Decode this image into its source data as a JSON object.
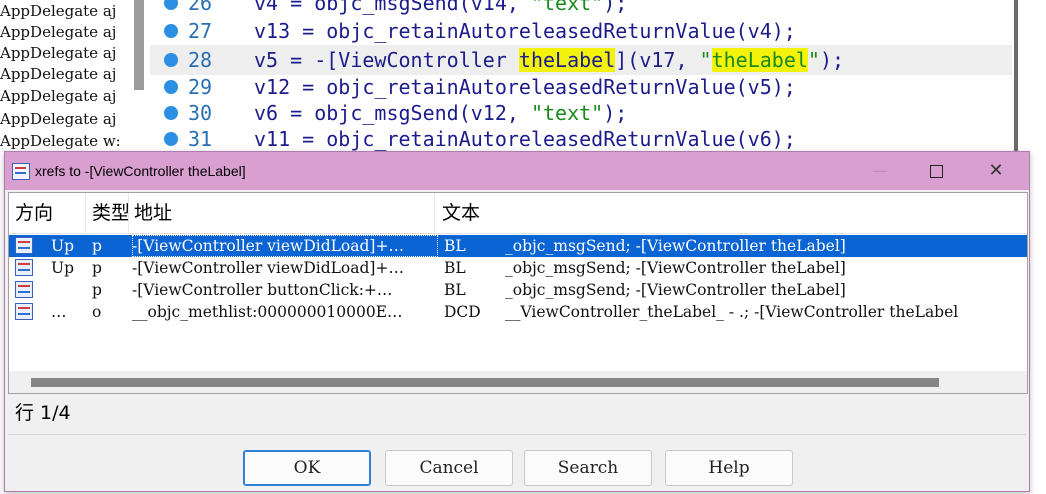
{
  "left_pane": {
    "functions": [
      "AppDelegate aj",
      "AppDelegate aj",
      "AppDelegate aj",
      "AppDelegate aj",
      "AppDelegate aj",
      "AppDelegate aj",
      "AppDelegate w:"
    ]
  },
  "code": {
    "lines": [
      {
        "num": "26",
        "pre": "v4 = objc_msgSend(v14, ",
        "str": "\"text\"",
        "post": ");"
      },
      {
        "num": "27",
        "text": "v13 = objc_retainAutoreleasedReturnValue(v4);"
      },
      {
        "num": "28",
        "pre": "v5 = -[ViewController ",
        "hl1": "theLabel",
        "mid": "](v17, ",
        "q1": "\"",
        "hl2": "theLabel",
        "q2": "\"",
        "post": ");"
      },
      {
        "num": "29",
        "text": "v12 = objc_retainAutoreleasedReturnValue(v5);"
      },
      {
        "num": "30",
        "pre": "v6 = objc_msgSend(v12, ",
        "str": "\"text\"",
        "post": ");"
      },
      {
        "num": "31",
        "text": "v11 = objc_retainAutoreleasedReturnValue(v6);"
      }
    ]
  },
  "dialog": {
    "title": "xrefs to -[ViewController theLabel]",
    "columns": {
      "direction": "方向",
      "type": "类型",
      "address": "地址",
      "text": "文本"
    },
    "rows": [
      {
        "dir": "Up",
        "type": "p",
        "address": "-[ViewController viewDidLoad]+…",
        "mnemonic": "BL",
        "text": "_objc_msgSend; -[ViewController theLabel]"
      },
      {
        "dir": "Up",
        "type": "p",
        "address": "-[ViewController viewDidLoad]+…",
        "mnemonic": "BL",
        "text": "_objc_msgSend; -[ViewController theLabel]"
      },
      {
        "dir": "",
        "type": "p",
        "address": "-[ViewController buttonClick:+…",
        "mnemonic": "BL",
        "text": "_objc_msgSend; -[ViewController theLabel]"
      },
      {
        "dir": "…",
        "type": "o",
        "address": "__objc_methlist:000000010000E…",
        "mnemonic": "DCD",
        "text": "__ViewController_theLabel_ - .; -[ViewController theLabel"
      }
    ],
    "row_count": "行 1/4",
    "buttons": {
      "ok": "OK",
      "cancel": "Cancel",
      "search": "Search",
      "help": "Help"
    },
    "window_buttons": {
      "minimize": "—",
      "close": "✕"
    }
  },
  "colors": {
    "selection": "#0a64d4",
    "titlebar": "#d89fd0",
    "highlight": "#f2f20a"
  }
}
